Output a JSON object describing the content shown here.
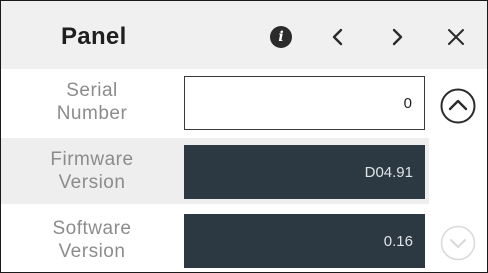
{
  "header": {
    "title": "Panel",
    "icons": [
      "info-icon",
      "chevron-left-icon",
      "chevron-right-icon",
      "close-icon"
    ]
  },
  "fields": [
    {
      "label": "Serial Number",
      "value": "0",
      "editable": true
    },
    {
      "label": "Firmware Version",
      "value": "D04.91",
      "editable": false
    },
    {
      "label": "Software Version",
      "value": "0.16",
      "editable": false
    }
  ],
  "scroll": {
    "up_icon": "chevron-up-circle-icon",
    "down_icon": "chevron-down-circle-icon",
    "down_enabled": false
  },
  "colors": {
    "header_bg": "#f0f0f0",
    "readonly_field_bg": "#2c3943",
    "label_text": "#8c8c8c",
    "row_alt_bg": "#eeeeee"
  }
}
